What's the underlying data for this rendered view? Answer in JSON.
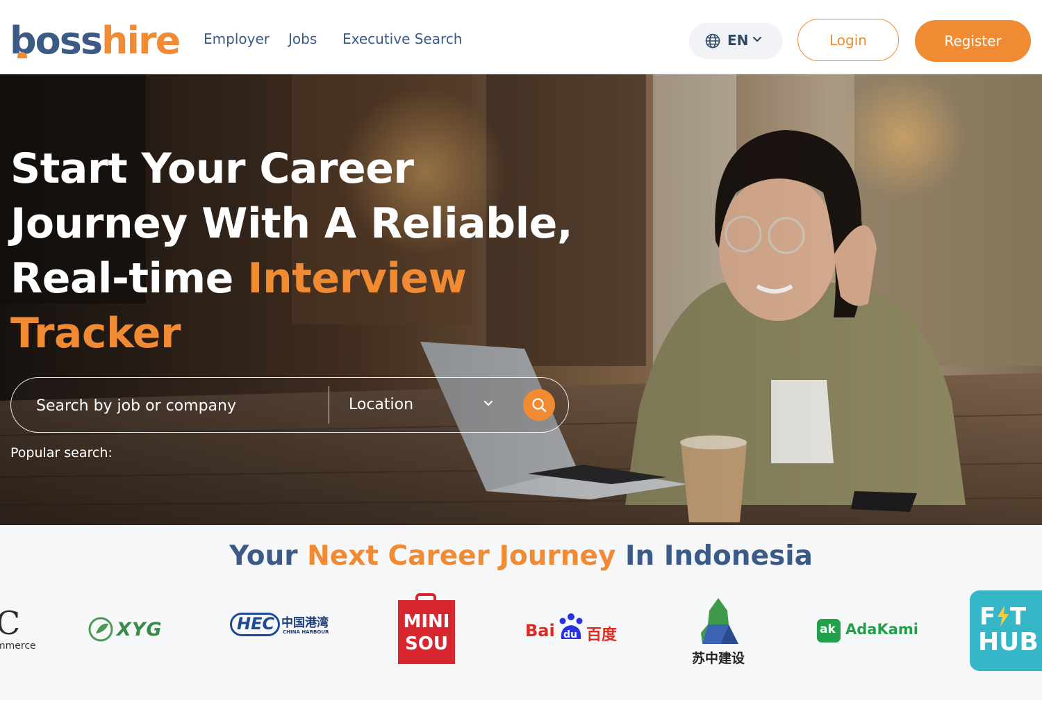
{
  "header": {
    "logo_boss": "boss",
    "logo_hire": "hire",
    "nav": {
      "employer": "Employer",
      "jobs": "Jobs",
      "executive_search": "Executive Search"
    },
    "language": "EN",
    "login": "Login",
    "register": "Register"
  },
  "hero": {
    "title_line1": "Start Your Career",
    "title_line2": "Journey With A Reliable,",
    "title_line3_pre": "Real-time ",
    "title_line3_accent": "Interview",
    "title_line4_accent": "Tracker",
    "search_placeholder": "Search by job or company",
    "location_label": "Location",
    "popular_label": "Popular search:"
  },
  "partners": {
    "title_pre": "Your ",
    "title_accent": "Next Career Journey",
    "title_post": " In Indonesia",
    "logos": {
      "cut_c": "C",
      "cut_commerce": "mmerce",
      "xyg": "XYG",
      "hec": "HEC",
      "hec_cn": "中国港湾",
      "hec_en": "CHINA HARBOUR",
      "miniso_1": "MINI",
      "miniso_2": "SOU",
      "baidu_1": "Bai",
      "baidu_2": "du",
      "baidu_cn": "百度",
      "suzhong_cn": "苏中建设",
      "adakami_mark": "ak",
      "adakami": "AdaKami",
      "fithub_1": "F",
      "fithub_2": "T",
      "fithub_3": "HUB"
    }
  },
  "colors": {
    "brand_blue": "#3c5a86",
    "brand_orange": "#f08a33"
  }
}
